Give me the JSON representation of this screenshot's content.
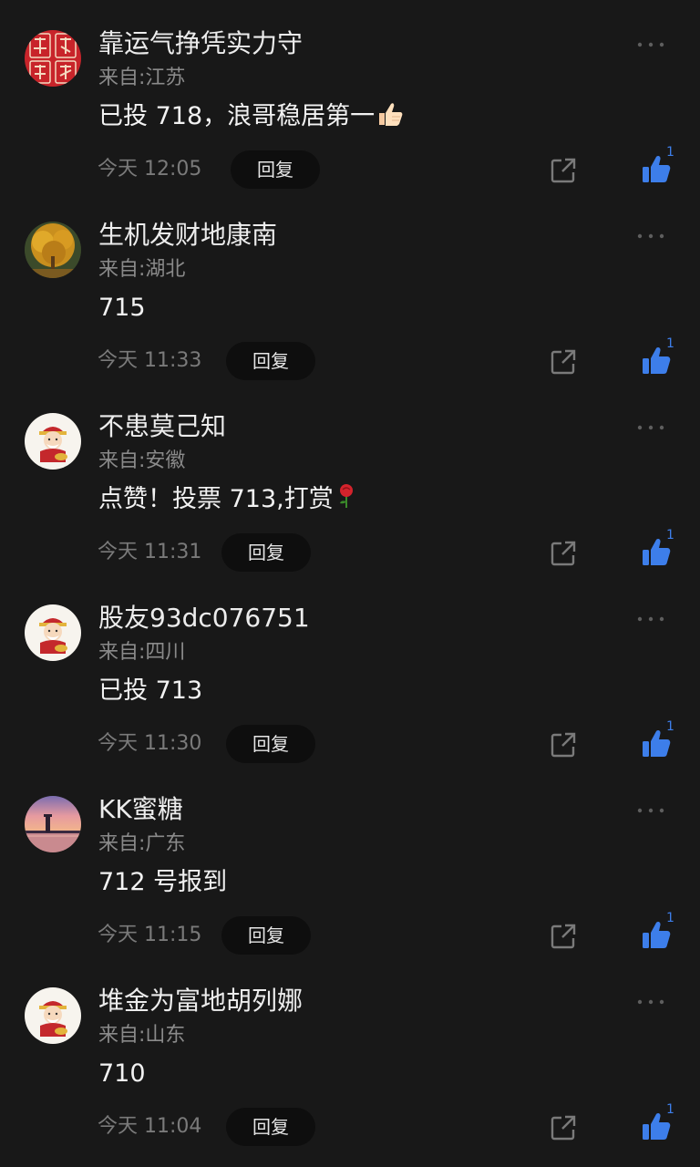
{
  "comments": [
    {
      "name": "靠运气挣凭实力守",
      "location": "来自:江苏",
      "content": "已投 718，浪哥稳居第一",
      "content_emoji": "thumbs-up-emoji",
      "time": "今天 12:05",
      "reply_label": "回复",
      "like_count": "1",
      "avatar": "red-calligraphy-avatar"
    },
    {
      "name": "生机发财地康南",
      "location": "来自:湖北",
      "content": "715",
      "time": "今天 11:33",
      "reply_label": "回复",
      "like_count": "1",
      "avatar": "golden-tree-avatar"
    },
    {
      "name": "不患莫己知",
      "location": "来自:安徽",
      "content": "点赞！投票 713,打赏",
      "content_emoji": "rose-emoji",
      "time": "今天 11:31",
      "reply_label": "回复",
      "like_count": "1",
      "avatar": "fortune-god-avatar"
    },
    {
      "name": "股友93dc076751",
      "location": "来自:四川",
      "content": "已投 713",
      "time": "今天 11:30",
      "reply_label": "回复",
      "like_count": "1",
      "avatar": "fortune-god-avatar"
    },
    {
      "name": "KK蜜糖",
      "location": "来自:广东",
      "content": "712 号报到",
      "time": "今天 11:15",
      "reply_label": "回复",
      "like_count": "1",
      "avatar": "sunset-lighthouse-avatar"
    },
    {
      "name": "堆金为富地胡列娜",
      "location": "来自:山东",
      "content": "710",
      "time": "今天 11:04",
      "reply_label": "回复",
      "like_count": "1",
      "avatar": "fortune-god-avatar"
    }
  ],
  "colors": {
    "background": "#181818",
    "like_blue": "#3d7eea",
    "muted_text": "#8a8a8a"
  }
}
